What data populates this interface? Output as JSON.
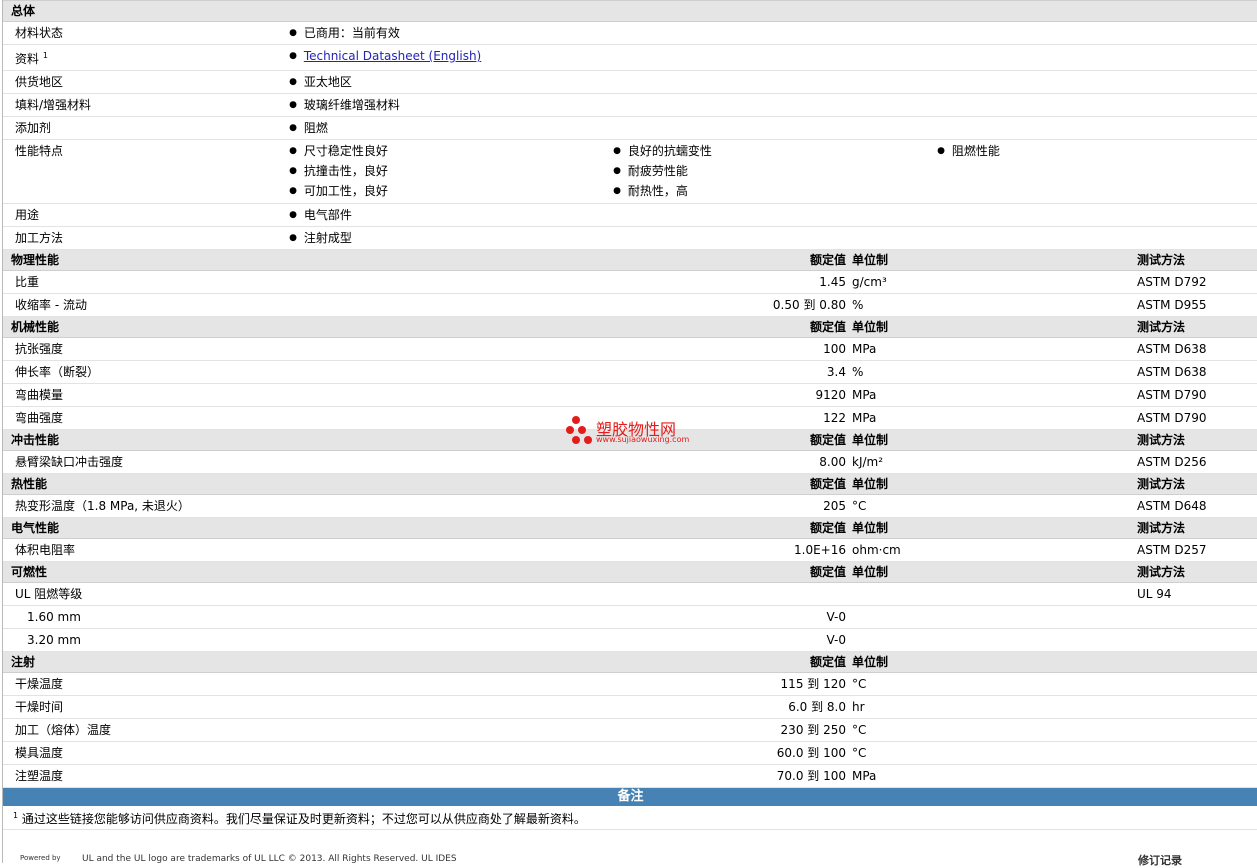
{
  "general": {
    "section_title": "总体",
    "rows": [
      {
        "label": "材料状态",
        "value": "已商用：当前有效"
      },
      {
        "label": "资料",
        "sup": "1",
        "link": "Technical Datasheet (English)"
      },
      {
        "label": "供货地区",
        "value": "亚太地区"
      },
      {
        "label": "填料/增强材料",
        "value": "玻璃纤维增强材料"
      },
      {
        "label": "添加剂",
        "value": "阻燃"
      }
    ],
    "features": {
      "label": "性能特点",
      "col1": [
        "尺寸稳定性良好",
        "抗撞击性，良好",
        "可加工性，良好"
      ],
      "col2": [
        "良好的抗蠕变性",
        "耐疲劳性能",
        "耐热性，高"
      ],
      "col3": [
        "阻燃性能"
      ]
    },
    "rows2": [
      {
        "label": "用途",
        "value": "电气部件"
      },
      {
        "label": "加工方法",
        "value": "注射成型"
      }
    ]
  },
  "headers": {
    "nominal": "额定值",
    "unit": "单位制",
    "test": "测试方法"
  },
  "physical": {
    "title": "物理性能",
    "rows": [
      {
        "label": "比重",
        "value": "1.45",
        "unit": "g/cm³",
        "test": "ASTM D792"
      },
      {
        "label": "收缩率 - 流动",
        "value": "0.50 到  0.80",
        "unit": "%",
        "test": "ASTM D955"
      }
    ]
  },
  "mechanical": {
    "title": "机械性能",
    "rows": [
      {
        "label": "抗张强度",
        "value": "100",
        "unit": "MPa",
        "test": "ASTM D638"
      },
      {
        "label": "伸长率（断裂）",
        "value": "3.4",
        "unit": "%",
        "test": "ASTM D638"
      },
      {
        "label": "弯曲模量",
        "value": "9120",
        "unit": "MPa",
        "test": "ASTM D790"
      },
      {
        "label": "弯曲强度",
        "value": "122",
        "unit": "MPa",
        "test": "ASTM D790"
      }
    ]
  },
  "impact": {
    "title": "冲击性能",
    "rows": [
      {
        "label": "悬臂梁缺口冲击强度",
        "value": "8.00",
        "unit": "kJ/m²",
        "test": "ASTM D256"
      }
    ]
  },
  "thermal": {
    "title": "热性能",
    "rows": [
      {
        "label": "热变形温度（1.8 MPa, 未退火）",
        "value": "205",
        "unit": "°C",
        "test": "ASTM D648"
      }
    ]
  },
  "electrical": {
    "title": "电气性能",
    "rows": [
      {
        "label": "体积电阻率",
        "value": "1.0E+16",
        "unit": "ohm·cm",
        "test": "ASTM D257"
      }
    ]
  },
  "flammability": {
    "title": "可燃性",
    "rows": [
      {
        "label": "UL 阻燃等级",
        "value": "",
        "unit": "",
        "test": "UL 94"
      },
      {
        "label": "1.60 mm",
        "value": "V-0",
        "unit": "",
        "test": ""
      },
      {
        "label": "3.20 mm",
        "value": "V-0",
        "unit": "",
        "test": ""
      }
    ]
  },
  "injection": {
    "title": "注射",
    "rows": [
      {
        "label": "干燥温度",
        "value": "115 到  120",
        "unit": "°C"
      },
      {
        "label": "干燥时间",
        "value": "6.0 到  8.0",
        "unit": "hr"
      },
      {
        "label": "加工（熔体）温度",
        "value": "230 到  250",
        "unit": "°C"
      },
      {
        "label": "模具温度",
        "value": "60.0 到  100",
        "unit": "°C"
      },
      {
        "label": "注塑温度",
        "value": "70.0 到  100",
        "unit": "MPa"
      }
    ]
  },
  "notes": {
    "title": "备注",
    "sup": "1",
    "text": "通过这些链接您能够访问供应商资料。我们尽量保证及时更新资料；不过您可以从供应商处了解最新资料。"
  },
  "watermark": {
    "text": "塑胶物性网",
    "sub": "www.sujiaowuxing.com"
  },
  "footer": {
    "powered": "Powered by",
    "trademark": "UL and the UL logo are trademarks of UL LLC © 2013. All Rights Reserved. UL IDES",
    "revision": "修订记录"
  },
  "colors": {
    "section_bg": "#e5e5e5",
    "note_header_bg": "#4682b4",
    "link": "#2323bb",
    "watermark": "#e31c1c"
  }
}
